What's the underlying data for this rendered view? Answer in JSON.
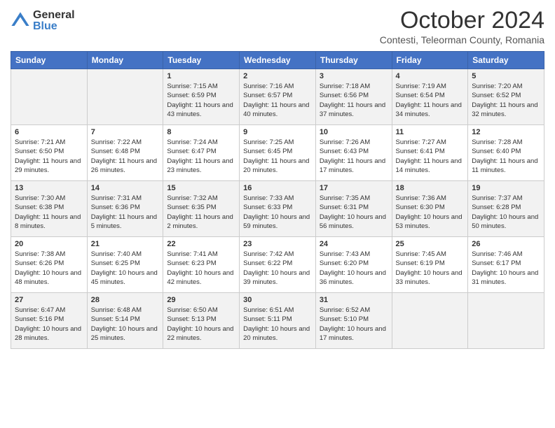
{
  "header": {
    "logo": {
      "general": "General",
      "blue": "Blue"
    },
    "title": "October 2024",
    "subtitle": "Contesti, Teleorman County, Romania"
  },
  "weekdays": [
    "Sunday",
    "Monday",
    "Tuesday",
    "Wednesday",
    "Thursday",
    "Friday",
    "Saturday"
  ],
  "weeks": [
    [
      null,
      null,
      {
        "day": "1",
        "sunrise": "Sunrise: 7:15 AM",
        "sunset": "Sunset: 6:59 PM",
        "daylight": "Daylight: 11 hours and 43 minutes."
      },
      {
        "day": "2",
        "sunrise": "Sunrise: 7:16 AM",
        "sunset": "Sunset: 6:57 PM",
        "daylight": "Daylight: 11 hours and 40 minutes."
      },
      {
        "day": "3",
        "sunrise": "Sunrise: 7:18 AM",
        "sunset": "Sunset: 6:56 PM",
        "daylight": "Daylight: 11 hours and 37 minutes."
      },
      {
        "day": "4",
        "sunrise": "Sunrise: 7:19 AM",
        "sunset": "Sunset: 6:54 PM",
        "daylight": "Daylight: 11 hours and 34 minutes."
      },
      {
        "day": "5",
        "sunrise": "Sunrise: 7:20 AM",
        "sunset": "Sunset: 6:52 PM",
        "daylight": "Daylight: 11 hours and 32 minutes."
      }
    ],
    [
      {
        "day": "6",
        "sunrise": "Sunrise: 7:21 AM",
        "sunset": "Sunset: 6:50 PM",
        "daylight": "Daylight: 11 hours and 29 minutes."
      },
      {
        "day": "7",
        "sunrise": "Sunrise: 7:22 AM",
        "sunset": "Sunset: 6:48 PM",
        "daylight": "Daylight: 11 hours and 26 minutes."
      },
      {
        "day": "8",
        "sunrise": "Sunrise: 7:24 AM",
        "sunset": "Sunset: 6:47 PM",
        "daylight": "Daylight: 11 hours and 23 minutes."
      },
      {
        "day": "9",
        "sunrise": "Sunrise: 7:25 AM",
        "sunset": "Sunset: 6:45 PM",
        "daylight": "Daylight: 11 hours and 20 minutes."
      },
      {
        "day": "10",
        "sunrise": "Sunrise: 7:26 AM",
        "sunset": "Sunset: 6:43 PM",
        "daylight": "Daylight: 11 hours and 17 minutes."
      },
      {
        "day": "11",
        "sunrise": "Sunrise: 7:27 AM",
        "sunset": "Sunset: 6:41 PM",
        "daylight": "Daylight: 11 hours and 14 minutes."
      },
      {
        "day": "12",
        "sunrise": "Sunrise: 7:28 AM",
        "sunset": "Sunset: 6:40 PM",
        "daylight": "Daylight: 11 hours and 11 minutes."
      }
    ],
    [
      {
        "day": "13",
        "sunrise": "Sunrise: 7:30 AM",
        "sunset": "Sunset: 6:38 PM",
        "daylight": "Daylight: 11 hours and 8 minutes."
      },
      {
        "day": "14",
        "sunrise": "Sunrise: 7:31 AM",
        "sunset": "Sunset: 6:36 PM",
        "daylight": "Daylight: 11 hours and 5 minutes."
      },
      {
        "day": "15",
        "sunrise": "Sunrise: 7:32 AM",
        "sunset": "Sunset: 6:35 PM",
        "daylight": "Daylight: 11 hours and 2 minutes."
      },
      {
        "day": "16",
        "sunrise": "Sunrise: 7:33 AM",
        "sunset": "Sunset: 6:33 PM",
        "daylight": "Daylight: 10 hours and 59 minutes."
      },
      {
        "day": "17",
        "sunrise": "Sunrise: 7:35 AM",
        "sunset": "Sunset: 6:31 PM",
        "daylight": "Daylight: 10 hours and 56 minutes."
      },
      {
        "day": "18",
        "sunrise": "Sunrise: 7:36 AM",
        "sunset": "Sunset: 6:30 PM",
        "daylight": "Daylight: 10 hours and 53 minutes."
      },
      {
        "day": "19",
        "sunrise": "Sunrise: 7:37 AM",
        "sunset": "Sunset: 6:28 PM",
        "daylight": "Daylight: 10 hours and 50 minutes."
      }
    ],
    [
      {
        "day": "20",
        "sunrise": "Sunrise: 7:38 AM",
        "sunset": "Sunset: 6:26 PM",
        "daylight": "Daylight: 10 hours and 48 minutes."
      },
      {
        "day": "21",
        "sunrise": "Sunrise: 7:40 AM",
        "sunset": "Sunset: 6:25 PM",
        "daylight": "Daylight: 10 hours and 45 minutes."
      },
      {
        "day": "22",
        "sunrise": "Sunrise: 7:41 AM",
        "sunset": "Sunset: 6:23 PM",
        "daylight": "Daylight: 10 hours and 42 minutes."
      },
      {
        "day": "23",
        "sunrise": "Sunrise: 7:42 AM",
        "sunset": "Sunset: 6:22 PM",
        "daylight": "Daylight: 10 hours and 39 minutes."
      },
      {
        "day": "24",
        "sunrise": "Sunrise: 7:43 AM",
        "sunset": "Sunset: 6:20 PM",
        "daylight": "Daylight: 10 hours and 36 minutes."
      },
      {
        "day": "25",
        "sunrise": "Sunrise: 7:45 AM",
        "sunset": "Sunset: 6:19 PM",
        "daylight": "Daylight: 10 hours and 33 minutes."
      },
      {
        "day": "26",
        "sunrise": "Sunrise: 7:46 AM",
        "sunset": "Sunset: 6:17 PM",
        "daylight": "Daylight: 10 hours and 31 minutes."
      }
    ],
    [
      {
        "day": "27",
        "sunrise": "Sunrise: 6:47 AM",
        "sunset": "Sunset: 5:16 PM",
        "daylight": "Daylight: 10 hours and 28 minutes."
      },
      {
        "day": "28",
        "sunrise": "Sunrise: 6:48 AM",
        "sunset": "Sunset: 5:14 PM",
        "daylight": "Daylight: 10 hours and 25 minutes."
      },
      {
        "day": "29",
        "sunrise": "Sunrise: 6:50 AM",
        "sunset": "Sunset: 5:13 PM",
        "daylight": "Daylight: 10 hours and 22 minutes."
      },
      {
        "day": "30",
        "sunrise": "Sunrise: 6:51 AM",
        "sunset": "Sunset: 5:11 PM",
        "daylight": "Daylight: 10 hours and 20 minutes."
      },
      {
        "day": "31",
        "sunrise": "Sunrise: 6:52 AM",
        "sunset": "Sunset: 5:10 PM",
        "daylight": "Daylight: 10 hours and 17 minutes."
      },
      null,
      null
    ]
  ]
}
